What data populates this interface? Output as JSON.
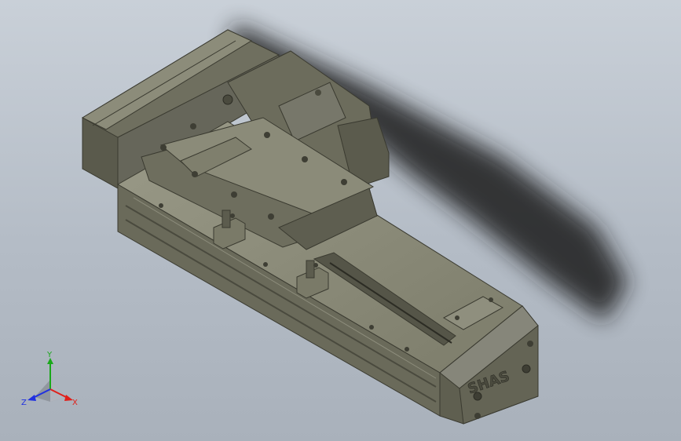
{
  "viewport": {
    "background_top": "#c9d0d8",
    "background_bottom": "#a9b1bb",
    "model": {
      "engraved_brand": "SHAS",
      "body_color": "#6a6a5a",
      "body_dark": "#4c4c40",
      "body_light": "#8a8a78",
      "shadow_color": "#1a1a1a"
    }
  },
  "triad": {
    "x_label": "X",
    "y_label": "Y",
    "z_label": "Z",
    "x_color": "#e0201a",
    "y_color": "#1aa81a",
    "z_color": "#2030e0"
  }
}
